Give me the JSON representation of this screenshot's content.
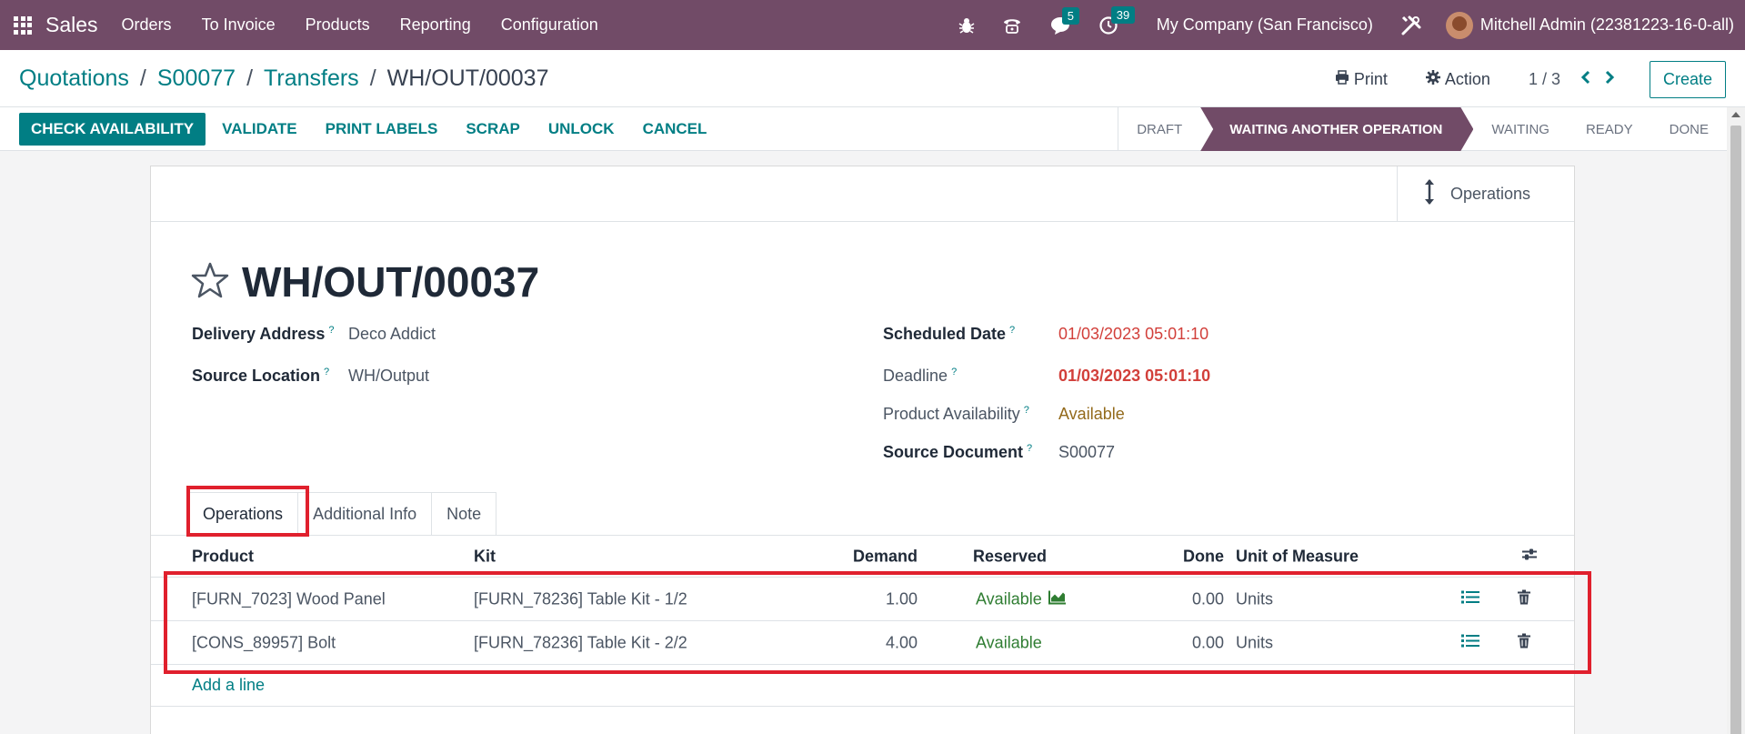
{
  "navbar": {
    "brand": "Sales",
    "menu": [
      "Orders",
      "To Invoice",
      "Products",
      "Reporting",
      "Configuration"
    ],
    "messages_count": "5",
    "activities_count": "39",
    "company": "My Company (San Francisco)",
    "user": "Mitchell Admin (22381223-16-0-all)"
  },
  "breadcrumb": {
    "items": [
      "Quotations",
      "S00077",
      "Transfers"
    ],
    "separator": "/",
    "current": "WH/OUT/00037"
  },
  "control": {
    "print_label": "Print",
    "action_label": "Action",
    "pager": "1 / 3",
    "create_label": "Create"
  },
  "actions": {
    "primary": "CHECK AVAILABILITY",
    "buttons": [
      "VALIDATE",
      "PRINT LABELS",
      "SCRAP",
      "UNLOCK",
      "CANCEL"
    ]
  },
  "stages": {
    "items": [
      "DRAFT",
      "WAITING ANOTHER OPERATION",
      "WAITING",
      "READY",
      "DONE"
    ],
    "active": "WAITING ANOTHER OPERATION"
  },
  "smart_button": {
    "label": "Operations"
  },
  "record": {
    "title": "WH/OUT/00037",
    "help_marker": "?",
    "delivery_address_label": "Delivery Address",
    "delivery_address": "Deco Addict",
    "source_location_label": "Source Location",
    "source_location": "WH/Output",
    "scheduled_date_label": "Scheduled Date",
    "scheduled_date": "01/03/2023 05:01:10",
    "deadline_label": "Deadline",
    "deadline": "01/03/2023 05:01:10",
    "availability_label": "Product Availability",
    "availability": "Available",
    "source_document_label": "Source Document",
    "source_document": "S00077"
  },
  "tabs": [
    "Operations",
    "Additional Info",
    "Note"
  ],
  "table": {
    "columns": [
      "Product",
      "Kit",
      "Demand",
      "Reserved",
      "Done",
      "Unit of Measure"
    ],
    "rows": [
      {
        "product": "[FURN_7023] Wood Panel",
        "kit": "[FURN_78236] Table Kit - 1/2",
        "demand": "1.00",
        "reserved": "Available",
        "done": "0.00",
        "uom": "Units"
      },
      {
        "product": "[CONS_89957] Bolt",
        "kit": "[FURN_78236] Table Kit - 2/2",
        "demand": "4.00",
        "reserved": "Available",
        "done": "0.00",
        "uom": "Units"
      }
    ],
    "add_line": "Add a line"
  },
  "colors": {
    "navbar": "#714b67",
    "primary": "#017e84",
    "highlight": "#e0202d",
    "deadline": "#d23f3a",
    "available": "#2f7d32"
  }
}
